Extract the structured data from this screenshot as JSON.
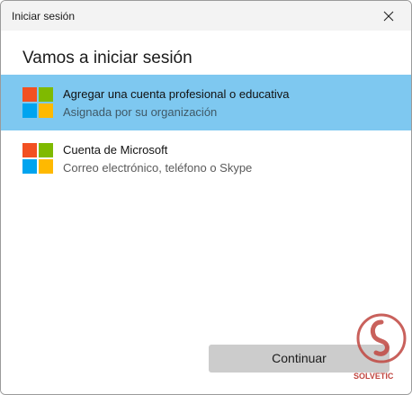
{
  "window": {
    "title": "Iniciar sesión",
    "close_icon": "close-icon"
  },
  "main": {
    "heading": "Vamos a iniciar sesión",
    "options": [
      {
        "title": "Agregar una cuenta profesional o educativa",
        "subtitle": "Asignada por su organización",
        "icon": "microsoft-logo-icon",
        "selected": true
      },
      {
        "title": "Cuenta de Microsoft",
        "subtitle": "Correo electrónico, teléfono o Skype",
        "icon": "microsoft-logo-icon",
        "selected": false
      }
    ],
    "continue_label": "Continuar"
  },
  "watermark": {
    "text": "SOLVETIC",
    "icon": "solvetic-logo-icon"
  },
  "colors": {
    "selected_row": "#7ec8f0",
    "button_bg": "#cccccc",
    "logo_red": "#f25022",
    "logo_green": "#7fba00",
    "logo_blue": "#00a4ef",
    "logo_yellow": "#ffb900"
  }
}
